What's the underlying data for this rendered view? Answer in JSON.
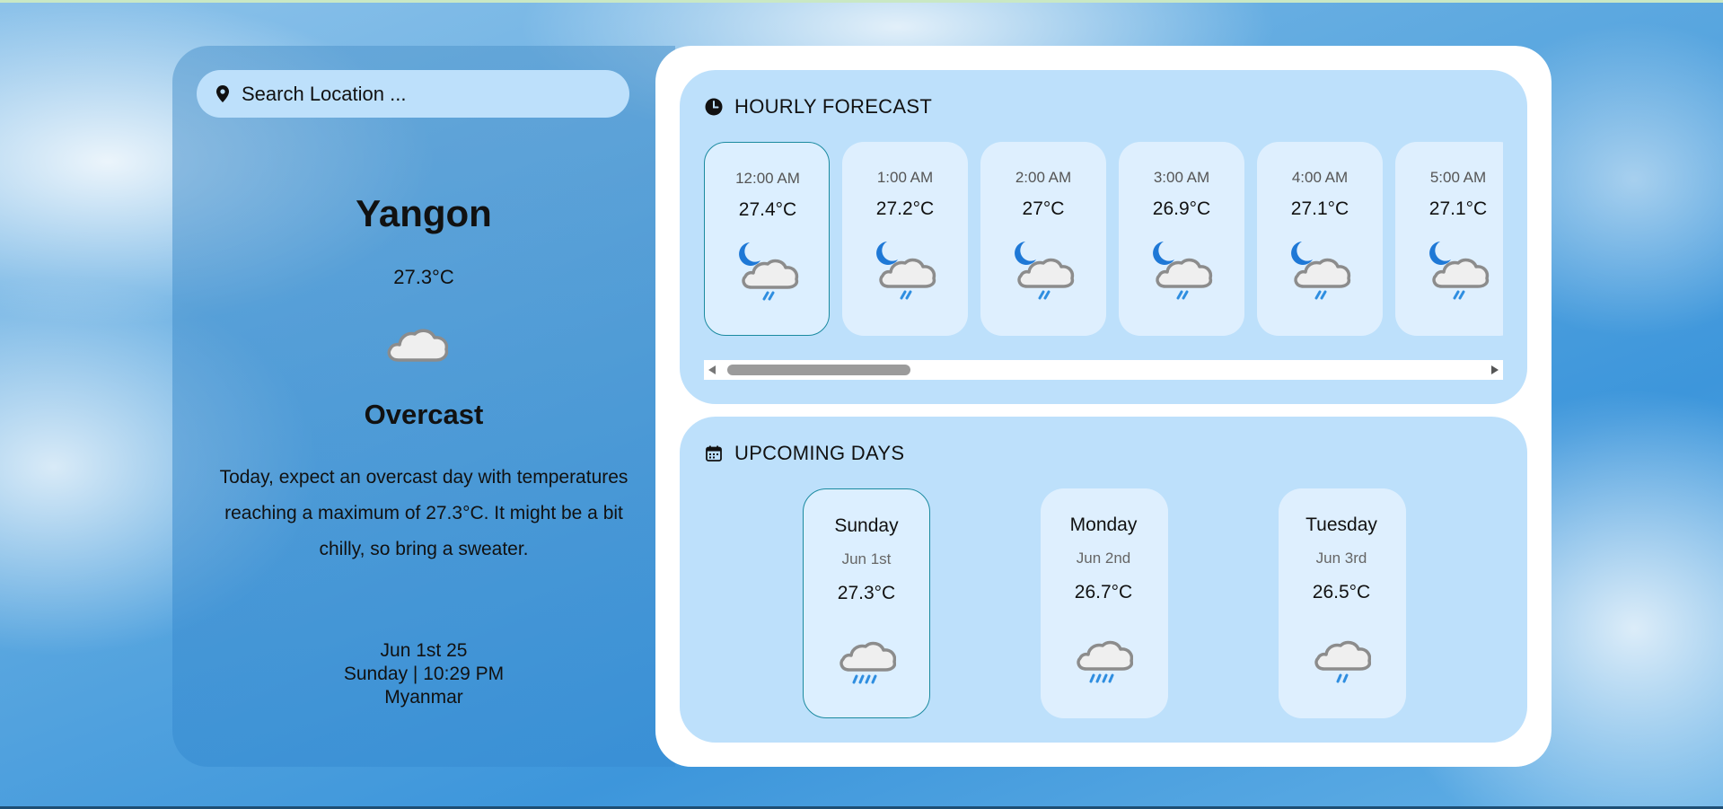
{
  "search": {
    "placeholder": "Search Location ..."
  },
  "current": {
    "city": "Yangon",
    "temp": "27.3°C",
    "icon": "cloud-icon",
    "condition": "Overcast",
    "description": "Today, expect an overcast day with temperatures reaching a maximum of 27.3°C. It might be a bit chilly, so bring a sweater.",
    "date": "Jun 1st 25",
    "day_time": "Sunday | 10:29 PM",
    "country": "Myanmar"
  },
  "hourly": {
    "title": "HOURLY FORECAST",
    "icon": "clock-icon",
    "items": [
      {
        "time": "12:00 AM",
        "temp": "27.4°C",
        "icon": "night-rain-icon"
      },
      {
        "time": "1:00 AM",
        "temp": "27.2°C",
        "icon": "night-rain-icon"
      },
      {
        "time": "2:00 AM",
        "temp": "27°C",
        "icon": "night-rain-icon"
      },
      {
        "time": "3:00 AM",
        "temp": "26.9°C",
        "icon": "night-rain-icon"
      },
      {
        "time": "4:00 AM",
        "temp": "27.1°C",
        "icon": "night-rain-icon"
      },
      {
        "time": "5:00 AM",
        "temp": "27.1°C",
        "icon": "night-rain-icon"
      }
    ]
  },
  "upcoming": {
    "title": "UPCOMING DAYS",
    "icon": "calendar-icon",
    "items": [
      {
        "day": "Sunday",
        "date": "Jun 1st",
        "temp": "27.3°C",
        "icon": "heavy-rain-icon"
      },
      {
        "day": "Monday",
        "date": "Jun 2nd",
        "temp": "26.7°C",
        "icon": "heavy-rain-icon"
      },
      {
        "day": "Tuesday",
        "date": "Jun 3rd",
        "temp": "26.5°C",
        "icon": "light-rain-icon"
      }
    ]
  },
  "colors": {
    "panel": "#bde0fb",
    "card": "#deeffe",
    "accent": "#1b8aa0",
    "moon": "#1e78d6",
    "rain": "#2f8ee0"
  }
}
